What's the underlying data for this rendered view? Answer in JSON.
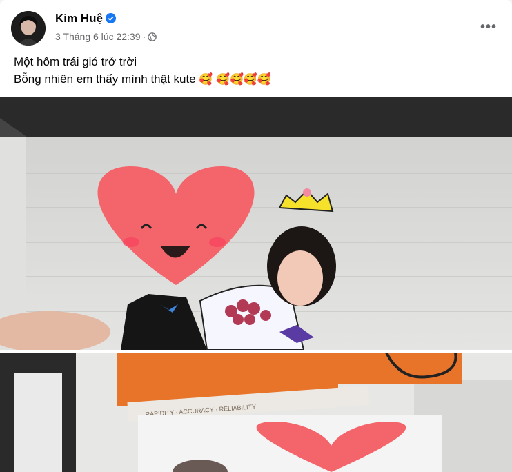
{
  "post": {
    "author": "Kim Huệ",
    "meta": "3 Tháng 6 lúc 22:39",
    "separator": "·",
    "more_label": "•••",
    "lines": [
      "Một hôm trái gió trở trời",
      "Bỗng nhiên em thấy mình thật kute"
    ],
    "emojis": [
      "🥰",
      "🥰🥰🥰🥰"
    ]
  },
  "photo2_box_text": "RAPIDITY · ACCURACY · RELIABILITY",
  "colors": {
    "verified": "#1877f2",
    "heart": "#f4656b",
    "box": "#e8742a"
  },
  "icons": [
    "verified-icon",
    "globe-icon",
    "more-options-icon"
  ]
}
